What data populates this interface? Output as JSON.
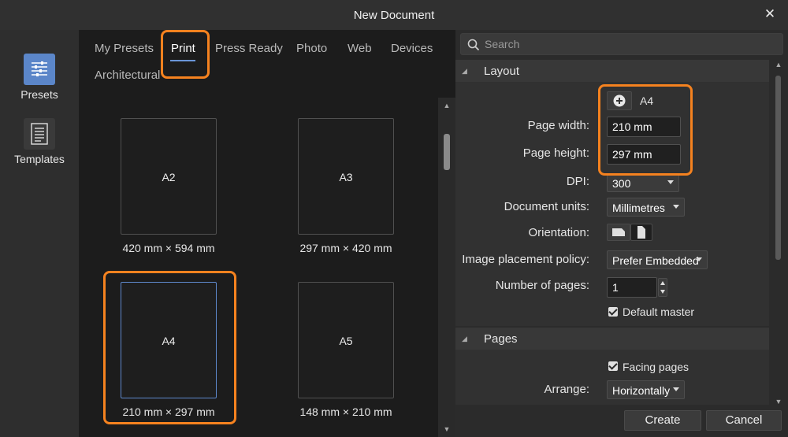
{
  "window": {
    "title": "New Document"
  },
  "sidebar": {
    "items": [
      {
        "label": "Presets",
        "icon": "sliders-icon",
        "active": true
      },
      {
        "label": "Templates",
        "icon": "document-icon",
        "active": false
      }
    ]
  },
  "tabs": [
    {
      "label": "My Presets"
    },
    {
      "label": "Print",
      "active": true
    },
    {
      "label": "Press Ready"
    },
    {
      "label": "Photo"
    },
    {
      "label": "Web"
    },
    {
      "label": "Devices"
    },
    {
      "label": "Architectural"
    }
  ],
  "presets": [
    {
      "name": "A2",
      "size": "420 mm × 594 mm"
    },
    {
      "name": "A3",
      "size": "297 mm × 420 mm"
    },
    {
      "name": "A4",
      "size": "210 mm × 297 mm",
      "selected": true
    },
    {
      "name": "A5",
      "size": "148 mm × 210 mm"
    }
  ],
  "search": {
    "placeholder": "Search"
  },
  "layout": {
    "title": "Layout",
    "preset_name": "A4",
    "page_width_label": "Page width:",
    "page_width": "210 mm",
    "page_height_label": "Page height:",
    "page_height": "297 mm",
    "dpi_label": "DPI:",
    "dpi": "300",
    "units_label": "Document units:",
    "units": "Millimetres",
    "orientation_label": "Orientation:",
    "placement_label": "Image placement policy:",
    "placement": "Prefer Embedded",
    "pages_label": "Number of pages:",
    "pages": "1",
    "default_master_label": "Default master"
  },
  "pages_section": {
    "title": "Pages",
    "facing_label": "Facing pages",
    "arrange_label": "Arrange:",
    "arrange": "Horizontally"
  },
  "footer": {
    "create": "Create",
    "cancel": "Cancel"
  },
  "colors": {
    "accent": "#5b86c9",
    "highlight": "#f5821f"
  }
}
